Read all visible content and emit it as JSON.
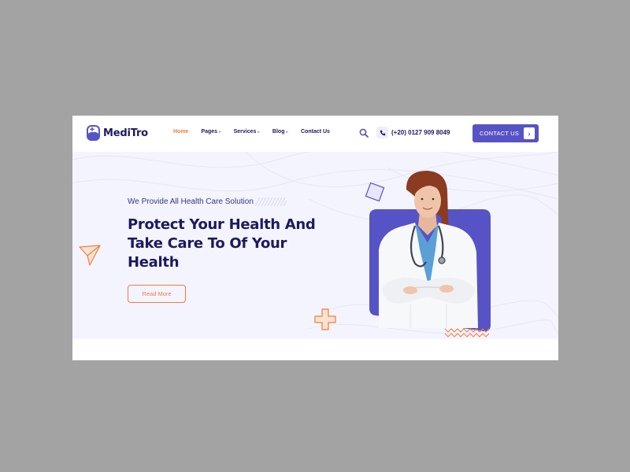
{
  "brand": {
    "name": "MediTro",
    "accent": "#5653c6",
    "orange": "#f07c3f",
    "navy": "#1c1a5e"
  },
  "nav": {
    "items": [
      {
        "label": "Home",
        "active": true,
        "dropdown": false
      },
      {
        "label": "Pages",
        "active": false,
        "dropdown": true
      },
      {
        "label": "Services",
        "active": false,
        "dropdown": true
      },
      {
        "label": "Blog",
        "active": false,
        "dropdown": true
      },
      {
        "label": "Contact Us",
        "active": false,
        "dropdown": false
      }
    ]
  },
  "header": {
    "search_icon": "search-icon",
    "phone": "(+20) 0127 909 8049",
    "phone_icon": "phone-icon",
    "contact_button": "CONTACT US",
    "contact_arrow": "›"
  },
  "hero": {
    "tagline": "We Provide All Health Care Solution",
    "headline_lines": [
      "Protect Your Health And",
      "Take Care To Of Your",
      "Health"
    ],
    "cta": "Read More"
  }
}
